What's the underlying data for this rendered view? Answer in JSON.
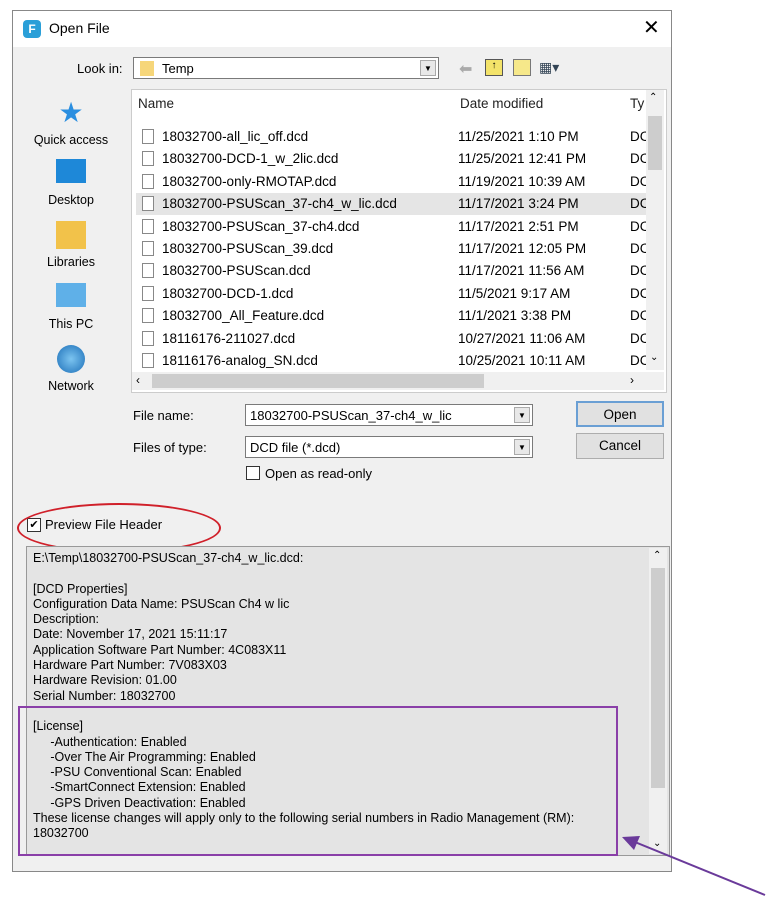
{
  "dialog": {
    "title": "Open File",
    "close": "✕"
  },
  "look_in": {
    "label": "Look in:",
    "value": "Temp"
  },
  "places": [
    {
      "label": "Quick access",
      "icon": "star-icon"
    },
    {
      "label": "Desktop",
      "icon": "desktop-icon"
    },
    {
      "label": "Libraries",
      "icon": "libraries-icon"
    },
    {
      "label": "This PC",
      "icon": "computer-icon"
    },
    {
      "label": "Network",
      "icon": "network-icon"
    }
  ],
  "columns": {
    "name": "Name",
    "date": "Date modified",
    "type": "Ty"
  },
  "files": [
    {
      "name": "18032700-all_lic_off.dcd",
      "date": "11/25/2021 1:10 PM",
      "type": "DC"
    },
    {
      "name": "18032700-DCD-1_w_2lic.dcd",
      "date": "11/25/2021 12:41 PM",
      "type": "DC"
    },
    {
      "name": "18032700-only-RMOTAP.dcd",
      "date": "11/19/2021 10:39 AM",
      "type": "DC"
    },
    {
      "name": "18032700-PSUScan_37-ch4_w_lic.dcd",
      "date": "11/17/2021 3:24 PM",
      "type": "DC",
      "selected": true
    },
    {
      "name": "18032700-PSUScan_37-ch4.dcd",
      "date": "11/17/2021 2:51 PM",
      "type": "DC"
    },
    {
      "name": "18032700-PSUScan_39.dcd",
      "date": "11/17/2021 12:05 PM",
      "type": "DC"
    },
    {
      "name": "18032700-PSUScan.dcd",
      "date": "11/17/2021 11:56 AM",
      "type": "DC"
    },
    {
      "name": "18032700-DCD-1.dcd",
      "date": "11/5/2021 9:17 AM",
      "type": "DC"
    },
    {
      "name": "18032700_All_Feature.dcd",
      "date": "11/1/2021 3:38 PM",
      "type": "DC"
    },
    {
      "name": "18116176-211027.dcd",
      "date": "10/27/2021 11:06 AM",
      "type": "DC"
    },
    {
      "name": "18116176-analog_SN.dcd",
      "date": "10/25/2021 10:11 AM",
      "type": "DC"
    }
  ],
  "file_name": {
    "label": "File name:",
    "value": "18032700-PSUScan_37-ch4_w_lic"
  },
  "file_type": {
    "label": "Files of type:",
    "value": "DCD file (*.dcd)"
  },
  "read_only": {
    "label": "Open as read-only",
    "checked": false
  },
  "buttons": {
    "open": "Open",
    "cancel": "Cancel"
  },
  "preview_toggle": {
    "label": "Preview File Header",
    "checked": true
  },
  "preview": {
    "header_lines": "E:\\Temp\\18032700-PSUScan_37-ch4_w_lic.dcd:\n\n[DCD Properties]\nConfiguration Data Name: PSUScan Ch4 w lic\nDescription:\nDate: November 17, 2021 15:11:17\nApplication Software Part Number: 4C083X11\nHardware Part Number: 7V083X03\nHardware Revision: 01.00\nSerial Number: 18032700\n\n[License]\n     -Authentication: Enabled\n     -Over The Air Programming: Enabled\n     -PSU Conventional Scan: Enabled\n     -SmartConnect Extension: Enabled\n     -GPS Driven Deactivation: Enabled\nThese license changes will apply only to the following serial numbers in Radio Management (RM):\n18032700"
  },
  "colors": {
    "highlight_ellipse": "#d0202a",
    "license_box": "#8a3fa8",
    "arrow": "#6a3a9a"
  }
}
